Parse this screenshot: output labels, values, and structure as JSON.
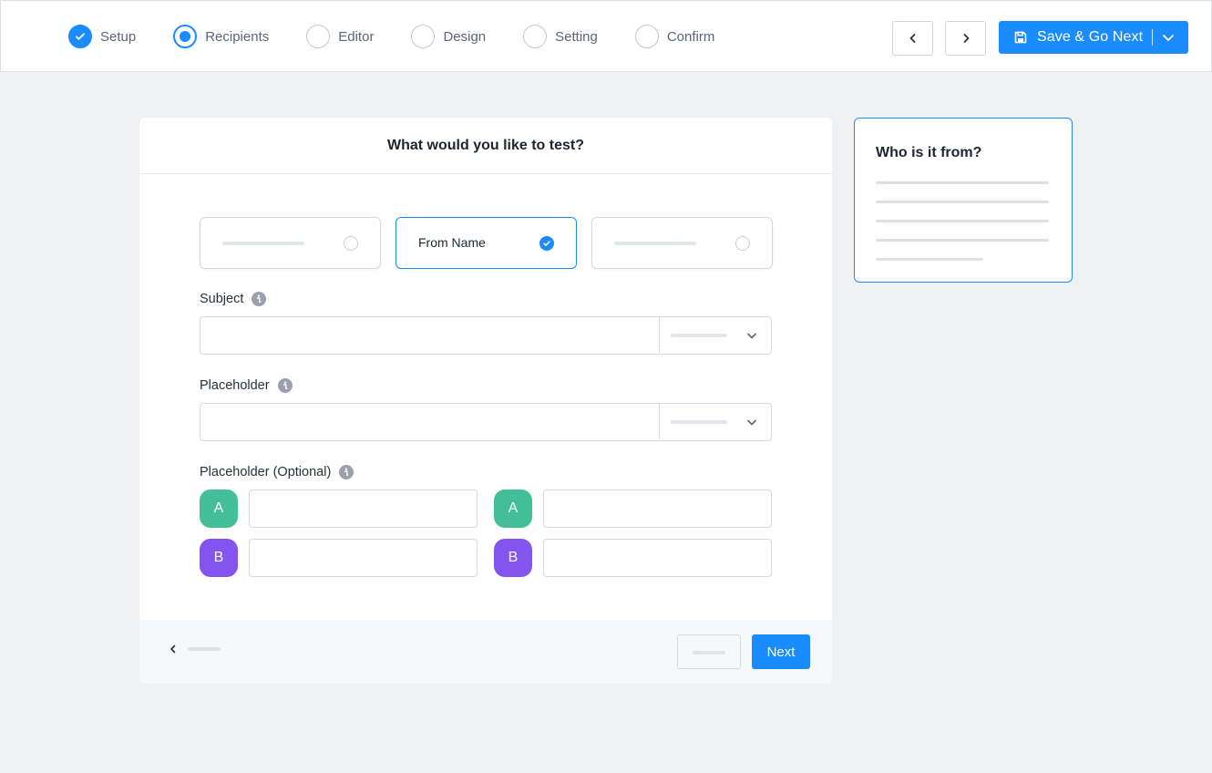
{
  "steps": [
    {
      "label": "Setup",
      "state": "done"
    },
    {
      "label": "Recipients",
      "state": "current"
    },
    {
      "label": "Editor",
      "state": "todo"
    },
    {
      "label": "Design",
      "state": "todo"
    },
    {
      "label": "Setting",
      "state": "todo"
    },
    {
      "label": "Confirm",
      "state": "todo"
    }
  ],
  "toolbar": {
    "prev_icon": "chevron-left-icon",
    "next_icon": "chevron-right-icon",
    "save_label": "Save & Go Next",
    "save_icon": "floppy-disk-icon",
    "dropdown_icon": "chevron-down-icon"
  },
  "card": {
    "title": "What would you like to test?",
    "options": [
      {
        "label": "",
        "selected": false
      },
      {
        "label": "From Name",
        "selected": true
      },
      {
        "label": "",
        "selected": false
      }
    ],
    "fields": {
      "subject_label": "Subject",
      "placeholder_label": "Placeholder",
      "placeholder_optional_label": "Placeholder (Optional)"
    },
    "variants": {
      "a_label": "A",
      "b_label": "B"
    },
    "footer": {
      "next_label": "Next"
    }
  },
  "side_panel": {
    "title": "Who is it from?"
  },
  "colors": {
    "accent": "#1a8cff",
    "variant_a": "#43bf97",
    "variant_b": "#8355ee",
    "background": "#f0f1f3"
  }
}
